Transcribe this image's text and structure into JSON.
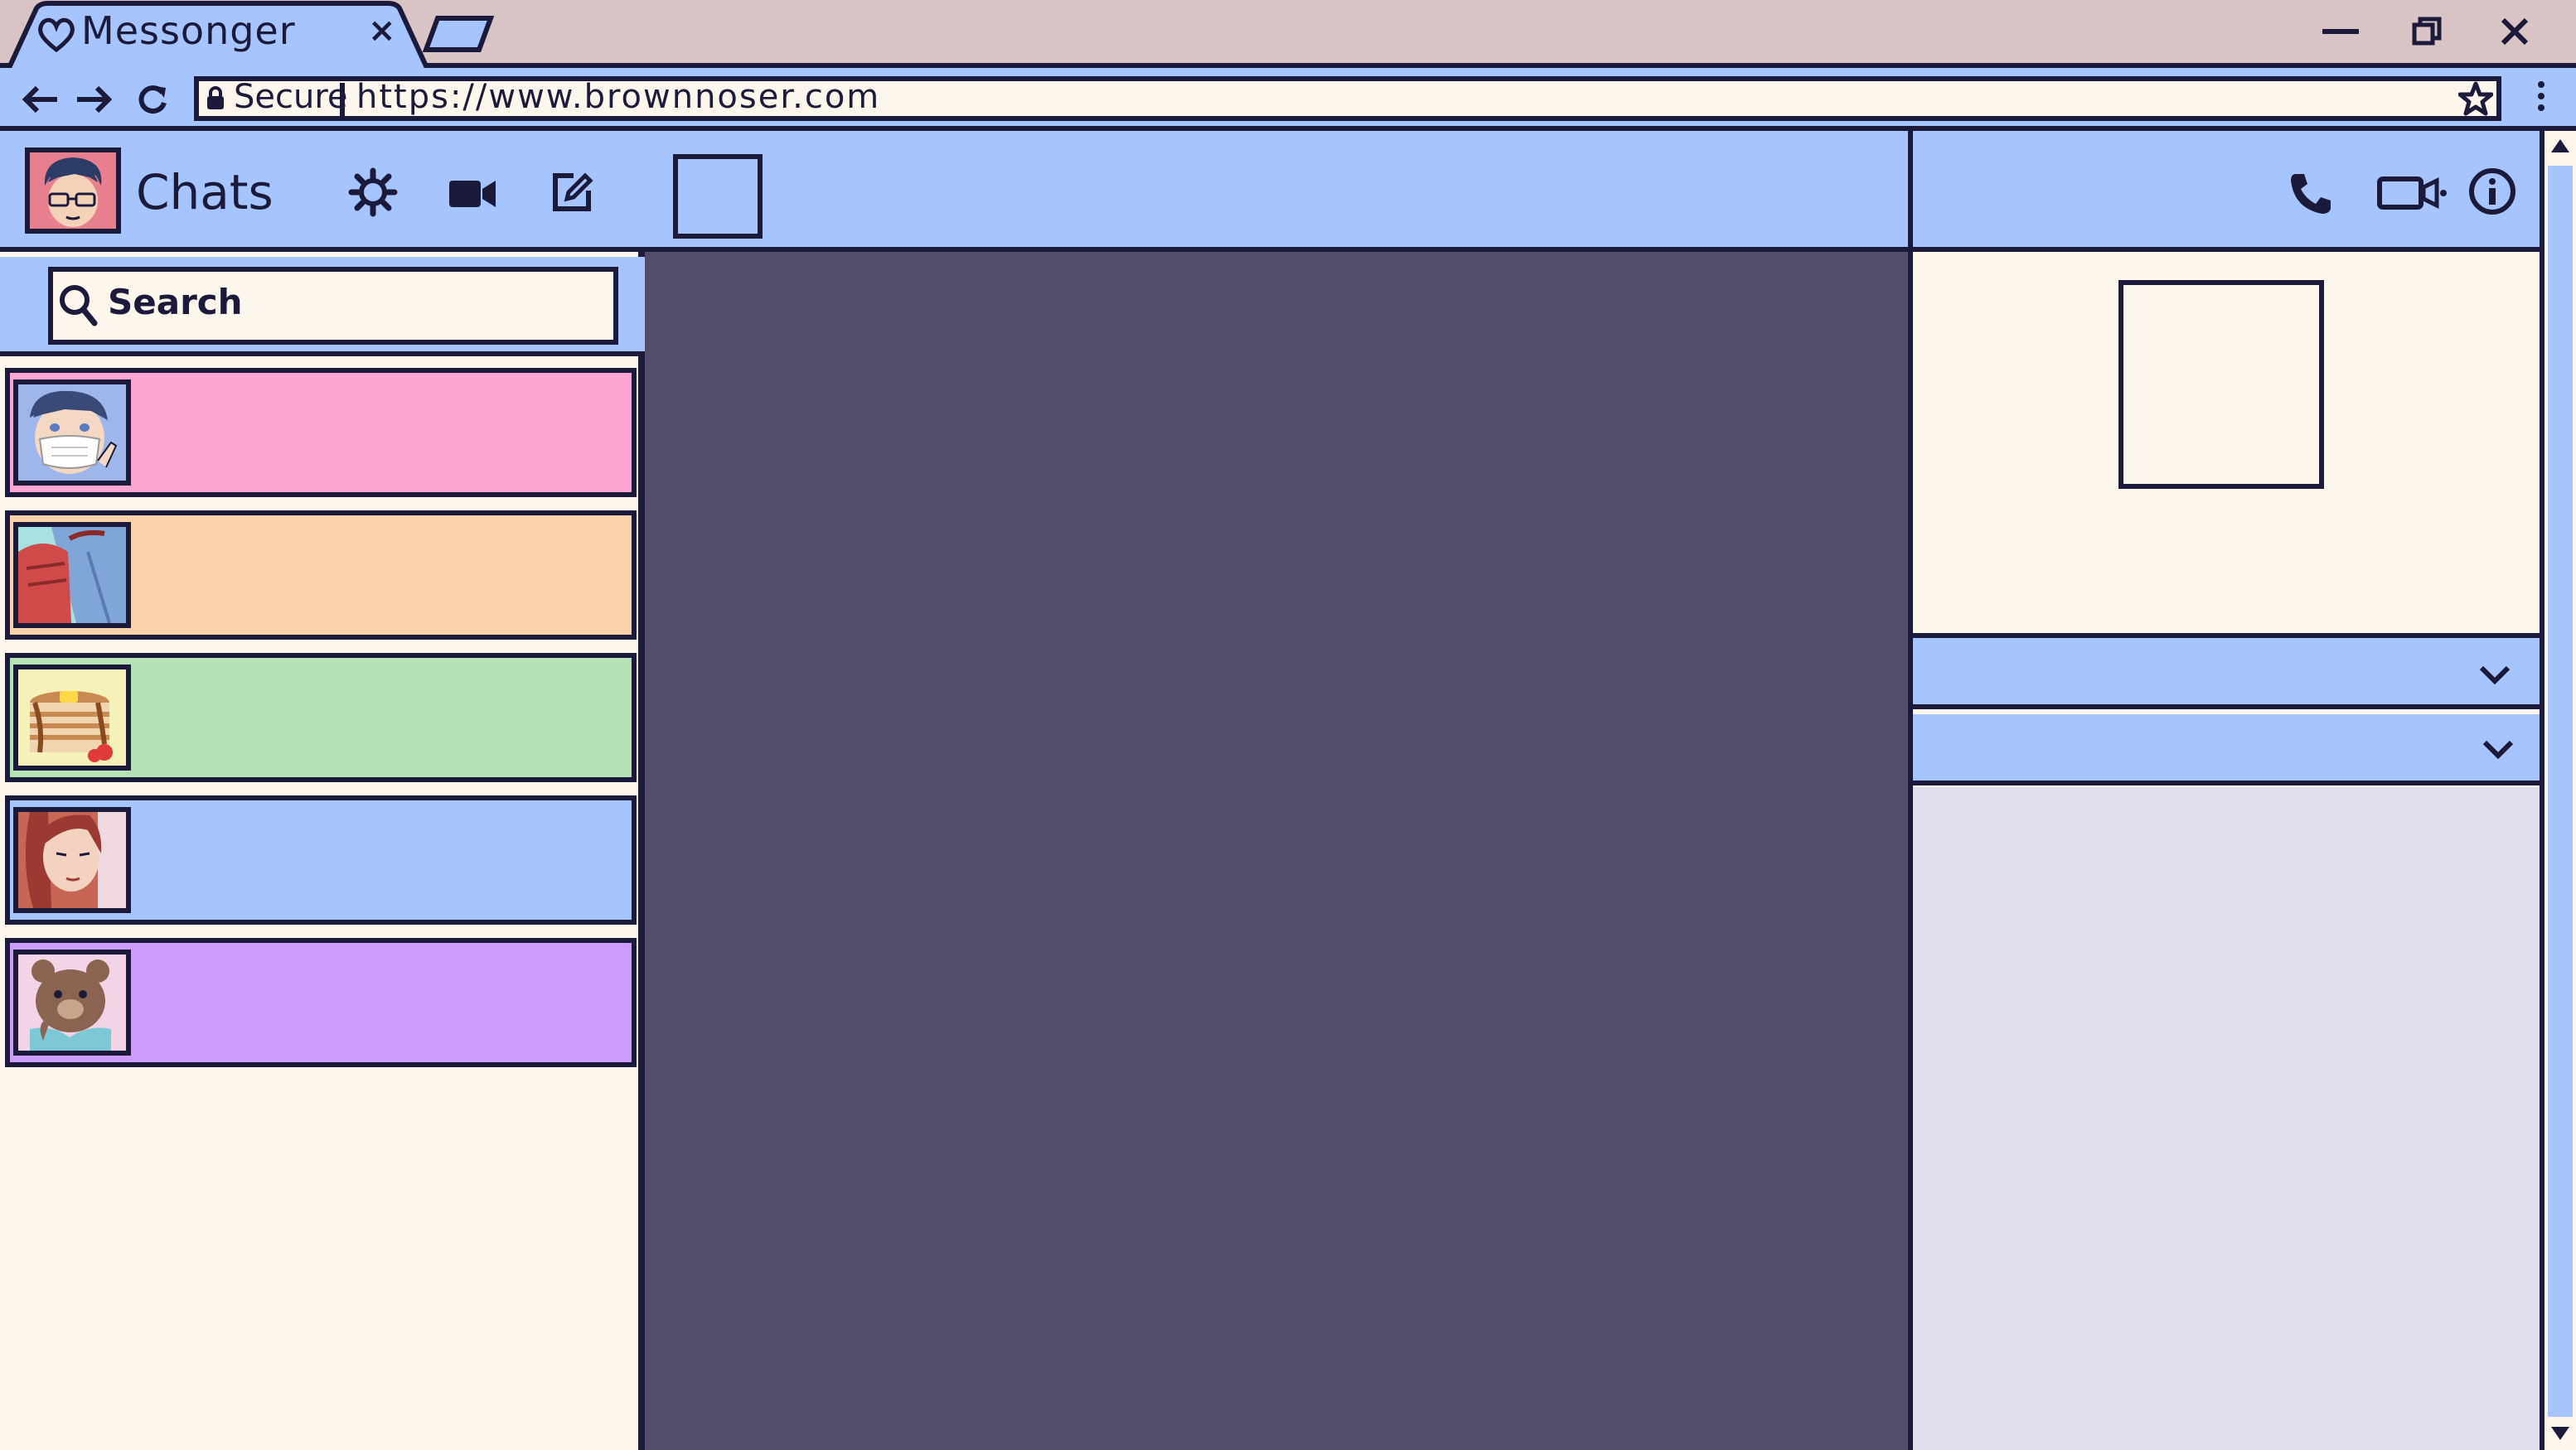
{
  "browser": {
    "tab_title": "Messonger",
    "tab_close": "×",
    "secure_label": "Secure",
    "url": "https://www.brownnoser.com"
  },
  "left_panel": {
    "title": "Chats",
    "search_placeholder": "Search",
    "chats": [
      {
        "color": "#fca5d2",
        "avatar_bg": "#9eb6ea",
        "avatar": "masked-guy-avatar"
      },
      {
        "color": "#fad1aa",
        "avatar_bg": "#a7e1e1",
        "avatar": "backpack-avatar"
      },
      {
        "color": "#b4e2b4",
        "avatar_bg": "#f6f1b8",
        "avatar": "pancakes-avatar"
      },
      {
        "color": "#a6c4fd",
        "avatar_bg": "#d07060",
        "avatar": "long-hair-girl-avatar"
      },
      {
        "color": "#cc9bfb",
        "avatar_bg": "#f3d4e6",
        "avatar": "teddy-bear-avatar"
      }
    ]
  },
  "colors": {
    "ink": "#1c1a3a",
    "header_blue": "#a6c4fd",
    "cream": "#fdf6ec",
    "titlebar": "#d8c4c4",
    "message_bg": "#514d6b",
    "right_body": "#e0dded"
  },
  "icons": {
    "tab": "heart-icon",
    "nav": [
      "back-arrow-icon",
      "forward-arrow-icon",
      "reload-icon"
    ],
    "address": [
      "lock-icon",
      "star-icon",
      "more-vertical-icon"
    ],
    "window": [
      "minimize-icon",
      "restore-icon",
      "close-icon"
    ],
    "left_header": [
      "gear-icon",
      "video-camera-icon",
      "compose-icon"
    ],
    "right_header": [
      "phone-icon",
      "video-call-icon",
      "info-icon"
    ]
  }
}
